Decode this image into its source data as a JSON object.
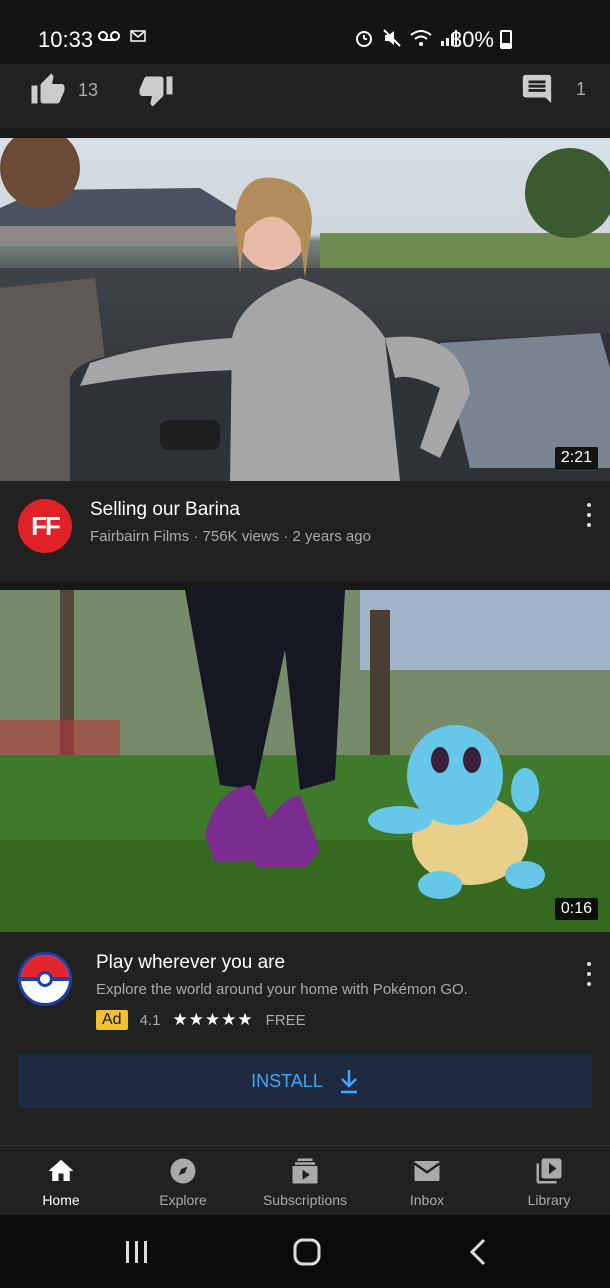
{
  "status_bar": {
    "time": "10:33",
    "battery": "30%",
    "battery_level": 0.3,
    "icons": [
      "voicemail-icon",
      "mail-icon",
      "alarm-icon",
      "mute-icon",
      "wifi-icon",
      "signal-icon",
      "battery-icon"
    ]
  },
  "actions": {
    "like_count": "13",
    "comment_count": "1"
  },
  "videos": [
    {
      "duration": "2:21",
      "avatar_text": "FF",
      "title": "Selling our Barina",
      "subtitle": "Fairbairn Films · 756K views · 2 years ago"
    }
  ],
  "ad": {
    "duration": "0:16",
    "title": "Play wherever you are",
    "description": "Explore the world around your home with Pokémon GO.",
    "badge": "Ad",
    "rating": "4.1",
    "rating_value": 4.1,
    "price": "FREE",
    "install_label": "INSTALL"
  },
  "bottom_nav": {
    "items": [
      {
        "label": "Home",
        "icon": "home-icon",
        "active": true
      },
      {
        "label": "Explore",
        "icon": "compass-icon",
        "active": false
      },
      {
        "label": "Subscriptions",
        "icon": "subscriptions-icon",
        "active": false
      },
      {
        "label": "Inbox",
        "icon": "inbox-icon",
        "active": false
      },
      {
        "label": "Library",
        "icon": "library-icon",
        "active": false
      }
    ]
  },
  "colors": {
    "background": "#212121",
    "accent_blue": "#3ea6ff",
    "ad_badge": "#f2c230",
    "channel_red": "#e02128"
  }
}
